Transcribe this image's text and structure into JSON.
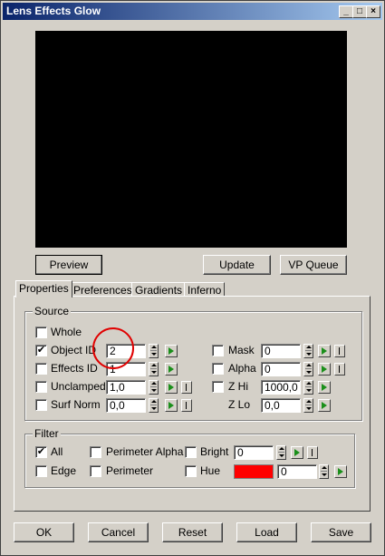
{
  "window": {
    "title": "Lens Effects Glow",
    "controls": [
      "_",
      "□",
      "×"
    ]
  },
  "buttons": {
    "preview": "Preview",
    "update": "Update",
    "vp_queue": "VP Queue",
    "ok": "OK",
    "cancel": "Cancel",
    "reset": "Reset",
    "load": "Load",
    "save": "Save"
  },
  "tabs": [
    "Properties",
    "Preferences",
    "Gradients",
    "Inferno"
  ],
  "active_tab": "Properties",
  "source": {
    "legend": "Source",
    "whole": {
      "label": "Whole",
      "checked": false
    },
    "object_id": {
      "label": "Object ID",
      "checked": true,
      "value": "2"
    },
    "effects_id": {
      "label": "Effects ID",
      "checked": false,
      "value": "1"
    },
    "unclamped": {
      "label": "Unclamped",
      "checked": false,
      "value": "1,0"
    },
    "surf_norm": {
      "label": "Surf Norm",
      "checked": false,
      "value": "0,0"
    },
    "mask": {
      "label": "Mask",
      "checked": false,
      "value": "0"
    },
    "alpha": {
      "label": "Alpha",
      "checked": false,
      "value": "0"
    },
    "z_hi": {
      "label": "Z Hi",
      "checked": false,
      "value": "1000,0"
    },
    "z_lo": {
      "label": "Z Lo",
      "value": "0,0"
    }
  },
  "filter": {
    "legend": "Filter",
    "all": {
      "label": "All",
      "checked": true
    },
    "edge": {
      "label": "Edge",
      "checked": false
    },
    "perimeter_alpha": {
      "label": "Perimeter Alpha",
      "checked": false
    },
    "perimeter": {
      "label": "Perimeter",
      "checked": false
    },
    "bright": {
      "label": "Bright",
      "checked": false,
      "value": "0"
    },
    "hue": {
      "label": "Hue",
      "checked": false,
      "value": "0",
      "color": "#ff0000"
    }
  },
  "checkmark": "✔",
  "colors": {
    "title_start": "#0a246a",
    "title_end": "#a6caf0",
    "highlight_circle": "#e00000",
    "face": "#d4d0c8"
  }
}
